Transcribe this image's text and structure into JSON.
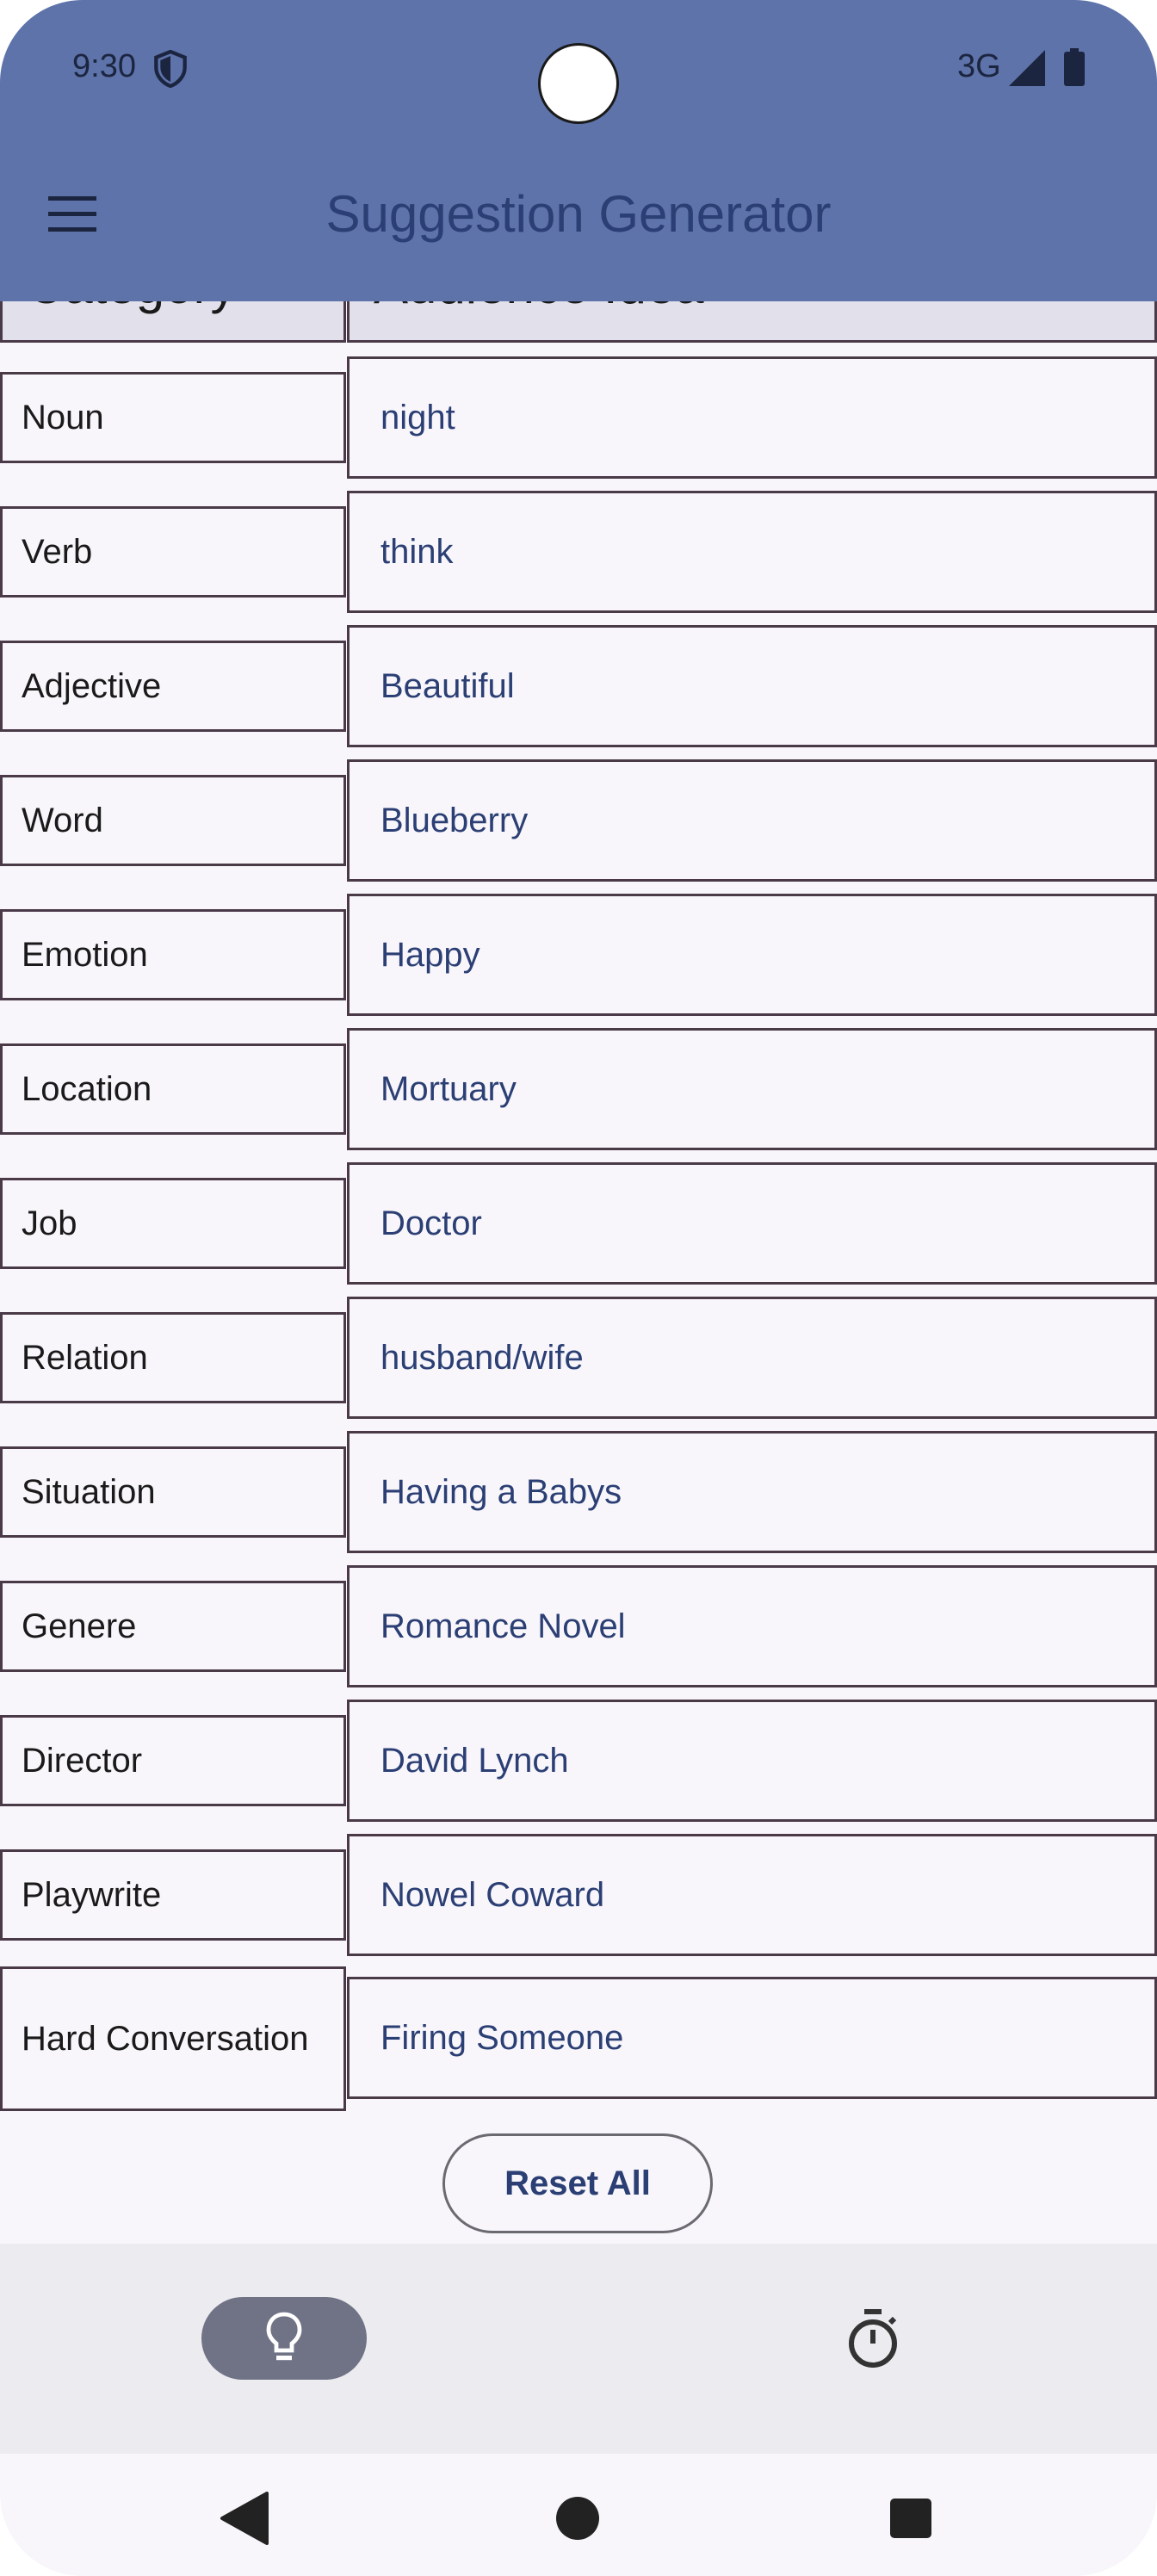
{
  "status_bar": {
    "time": "9:30",
    "network": "3G"
  },
  "app_bar": {
    "title": "Suggestion Generator"
  },
  "table": {
    "headers": [
      "Category",
      "Audience Idea"
    ],
    "rows": [
      {
        "category": "Noun",
        "value": "night"
      },
      {
        "category": "Verb",
        "value": "think"
      },
      {
        "category": "Adjective",
        "value": "Beautiful"
      },
      {
        "category": "Word",
        "value": "Blueberry"
      },
      {
        "category": "Emotion",
        "value": "Happy"
      },
      {
        "category": "Location",
        "value": "Mortuary"
      },
      {
        "category": "Job",
        "value": "Doctor"
      },
      {
        "category": "Relation",
        "value": "husband/wife"
      },
      {
        "category": "Situation",
        "value": "Having a Babys"
      },
      {
        "category": "Genere",
        "value": "Romance Novel"
      },
      {
        "category": "Director",
        "value": "David Lynch"
      },
      {
        "category": "Playwrite",
        "value": "Nowel Coward"
      },
      {
        "category": "Hard Conversation",
        "value": "Firing Someone"
      }
    ]
  },
  "reset_button": {
    "label": "Reset All"
  },
  "bottom_nav": {
    "items": [
      {
        "icon": "lightbulb-icon",
        "selected": true
      },
      {
        "icon": "timer-icon",
        "selected": false
      }
    ]
  },
  "colors": {
    "app_bar": "#5D73AA",
    "title_text": "#2B3F74",
    "background": "#F8F6FB",
    "header_cell": "#E2E1EB",
    "cell_border": "#4a3a48",
    "nav_selected_pill": "#6F7385",
    "bottom_nav_bg": "#ECEBF0"
  }
}
